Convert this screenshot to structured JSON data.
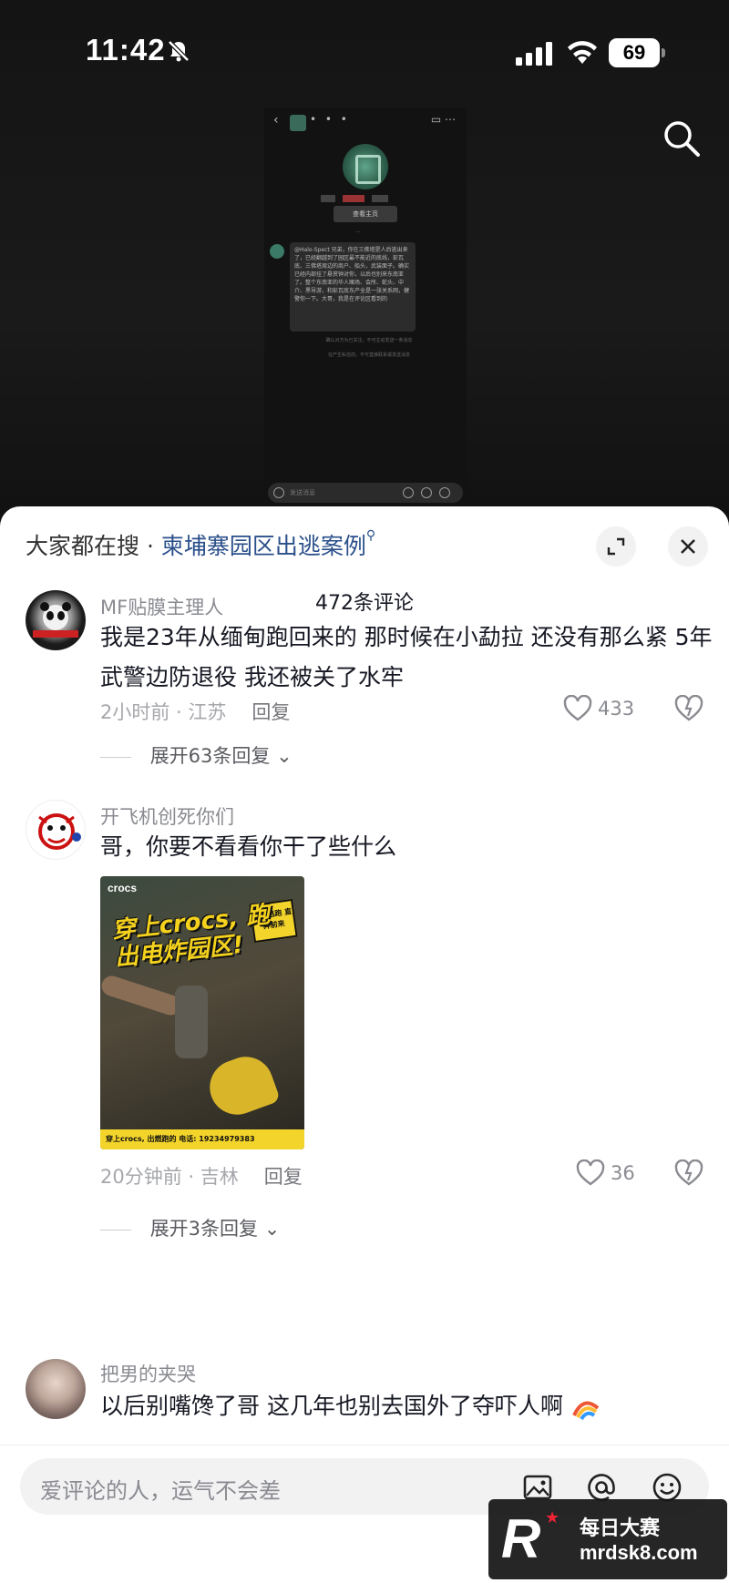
{
  "status_bar": {
    "time": "11:42",
    "battery": "69"
  },
  "embedded_video": {
    "button_label": "查看主页",
    "message": "@Halo-Spect 兄弟，你在三佛塔是人后逃出来了，已经翻越到了园区最不能近的底线，彭瓦底、三佛塔周边的商户、船头，武装面子。确实已经内部挂了悬赏钟对你，以后也别来东南亚了。整个东南亚的华人赌场、会所、蛇头、中介、黑导游，和彭瓦底东产全是一张关系网，健警你一下。大哥，我是在评论区看到的",
    "footnote_1": "确认对方为已关注，不可主动发送一条消息",
    "footnote_2": "在产生私信前，不可直接联系或发送消息",
    "input_placeholder": "发送消息"
  },
  "sheet": {
    "hot_search_prefix": "大家都在搜 · ",
    "hot_search_term": "柬埔寨园区出逃案例",
    "comment_count": "472条评论"
  },
  "comments": [
    {
      "username": "MF贴膜主理人",
      "text": "我是23年从缅甸跑回来的 那时候在小勐拉 还没有那么紧 5年武警边防退役 我还被关了水牢",
      "time_location": "2小时前 · 江苏",
      "reply_label": "回复",
      "likes": "433",
      "expand_label": "展开63条回复"
    },
    {
      "username": "开飞机创死你们",
      "text": "哥，你要不看看你干了些什么",
      "image": {
        "brand": "crocs",
        "headline": "穿上crocs, 跑出电炸园区!",
        "sticker": "园区逃跑 直奔前来",
        "footer": "穿上crocs, 出燃跑的 电话: 19234979383"
      },
      "time_location": "20分钟前 · 吉林",
      "reply_label": "回复",
      "likes": "36",
      "expand_label": "展开3条回复"
    },
    {
      "username": "把男的夹哭",
      "text": "以后别嘴馋了哥 这几年也别去国外了夺吓人啊"
    }
  ],
  "input_bar": {
    "placeholder": "爱评论的人，运气不会差"
  },
  "watermark": {
    "cn": "每日大赛",
    "url": "mrdsk8.com"
  },
  "colors": {
    "hot_search_link": "#2a4f8a",
    "crocs_yellow": "#f3d42a"
  }
}
